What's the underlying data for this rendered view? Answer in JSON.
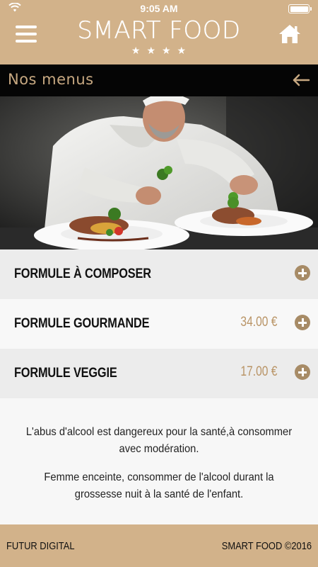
{
  "status_bar": {
    "time": "9:05 AM",
    "wifi_icon": "wifi-icon",
    "battery_icon": "battery-icon"
  },
  "header": {
    "brand": "SMART FOOD",
    "stars": "★★★★",
    "menu_icon": "hamburger-menu-icon",
    "home_icon": "home-icon",
    "background": "#d2b28a"
  },
  "section": {
    "title": "Nos menus",
    "back_icon": "arrow-left-icon",
    "accent": "#c7a881"
  },
  "hero": {
    "icon": "chef-plating-photo"
  },
  "menus": [
    {
      "name": "FORMULE À COMPOSER",
      "price": "",
      "add_icon": "plus-circle-icon"
    },
    {
      "name": "FORMULE GOURMANDE",
      "price": "34.00 €",
      "add_icon": "plus-circle-icon"
    },
    {
      "name": "FORMULE VEGGIE",
      "price": "17.00 €",
      "add_icon": "plus-circle-icon"
    }
  ],
  "notice": {
    "line1": "L'abus d'alcool est dangereux pour la santé,à consommer avec modération.",
    "line2": "Femme enceinte, consommer de l'alcool durant la grossesse nuit à la santé de l'enfant."
  },
  "footer": {
    "left": "FUTUR DIGITAL",
    "right": "SMART FOOD ©2016"
  }
}
